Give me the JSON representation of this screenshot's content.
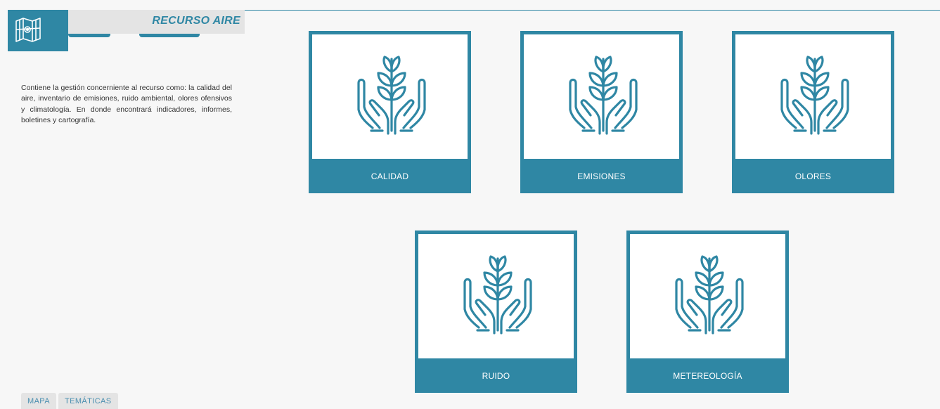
{
  "header": {
    "title": "RECURSO AIRE",
    "icon": "map-icon"
  },
  "description": "Contiene la gestión concerniente al recurso como: la calidad del aire, inventario de emisiones, ruido ambiental, olores ofensivos y climatología. En donde encontrará indicadores, informes, boletines y cartografía.",
  "bottom_tabs": [
    {
      "label": "MAPA"
    },
    {
      "label": "TEMÁTICAS"
    }
  ],
  "cards": [
    {
      "label": "CALIDAD",
      "icon": "hands-plant-icon"
    },
    {
      "label": "EMISIONES",
      "icon": "hands-plant-icon"
    },
    {
      "label": "OLORES",
      "icon": "hands-plant-icon"
    },
    {
      "label": "RUIDO",
      "icon": "hands-plant-icon"
    },
    {
      "label": "METEREOLOGÍA",
      "icon": "hands-plant-icon"
    }
  ],
  "colors": {
    "accent": "#2f87a4",
    "panel": "#e4e4e4",
    "background": "#f7f7f7"
  }
}
